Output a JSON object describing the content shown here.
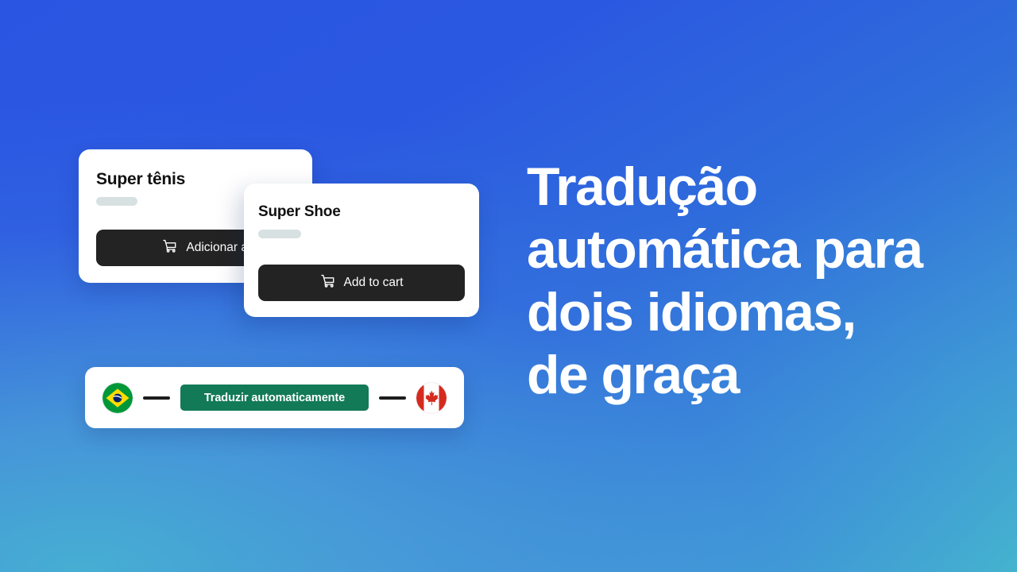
{
  "background": {
    "gradient_from": "#2a55e2",
    "gradient_mid": "#3e96d6",
    "gradient_to": "#45b4ce"
  },
  "headline": {
    "text": "Tradução\nautomática para\ndois idiomas,\nde graça",
    "color": "#ffffff"
  },
  "cards": [
    {
      "title": "Super tênis",
      "button_label": "Adicionar ao carrinho",
      "button_visible_label": "Adicionar ao",
      "cart_icon": "shopping-cart-icon",
      "button_color": "#232323",
      "placeholder_color": "#d7e1e1"
    },
    {
      "title": "Super Shoe",
      "button_label": "Add to cart",
      "button_visible_label": "Add to cart",
      "cart_icon": "shopping-cart-icon",
      "button_color": "#232323",
      "placeholder_color": "#d7e1e1"
    }
  ],
  "translate_bar": {
    "source_flag": "brazil-flag-icon",
    "target_flag": "canada-flag-icon",
    "button_label": "Traduzir automaticamente",
    "button_color": "#127a56",
    "connector_color": "#1d1d1d"
  }
}
